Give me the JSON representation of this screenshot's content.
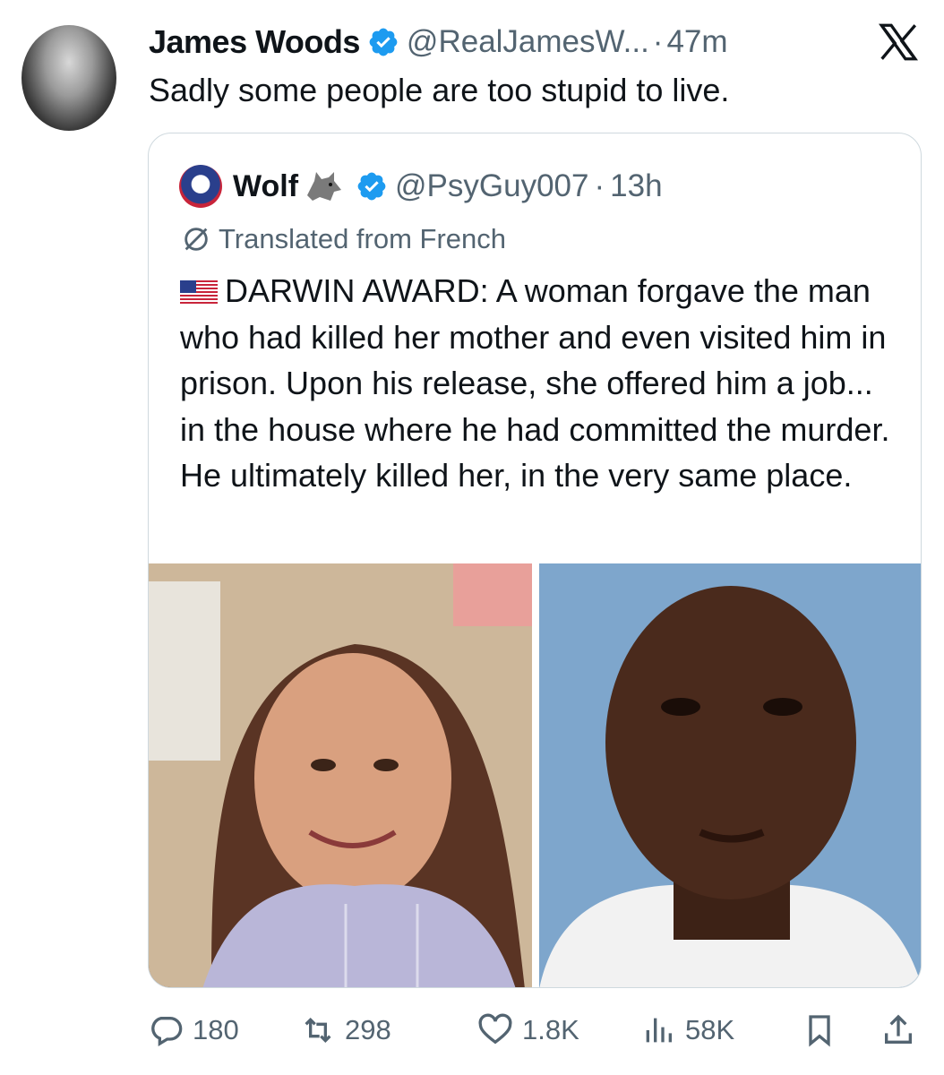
{
  "author": {
    "name": "James Woods",
    "handle": "@RealJamesW...",
    "separator": "·",
    "time": "47m",
    "text": "Sadly some people are too stupid to live."
  },
  "quote": {
    "name": "Wolf",
    "handle": "@PsyGuy007",
    "separator": "·",
    "time": "13h",
    "translated": "Translated from French",
    "text": "DARWIN AWARD: A woman forgave the man who had killed her mother and even visited him in prison. Upon his release, she offered him a job... in the house where he had committed the murder. He ultimately killed her, in the very same place."
  },
  "actions": {
    "replies": "180",
    "reposts": "298",
    "likes": "1.8K",
    "views": "58K"
  },
  "colors": {
    "verified": "#1d9bf0",
    "muted": "#536471",
    "text": "#0f1419",
    "border": "#cfd9de"
  },
  "icons": [
    "x-logo-icon",
    "verified-icon",
    "translate-icon",
    "flag-us-icon",
    "reply-icon",
    "repost-icon",
    "like-icon",
    "views-icon",
    "bookmark-icon",
    "share-icon"
  ]
}
